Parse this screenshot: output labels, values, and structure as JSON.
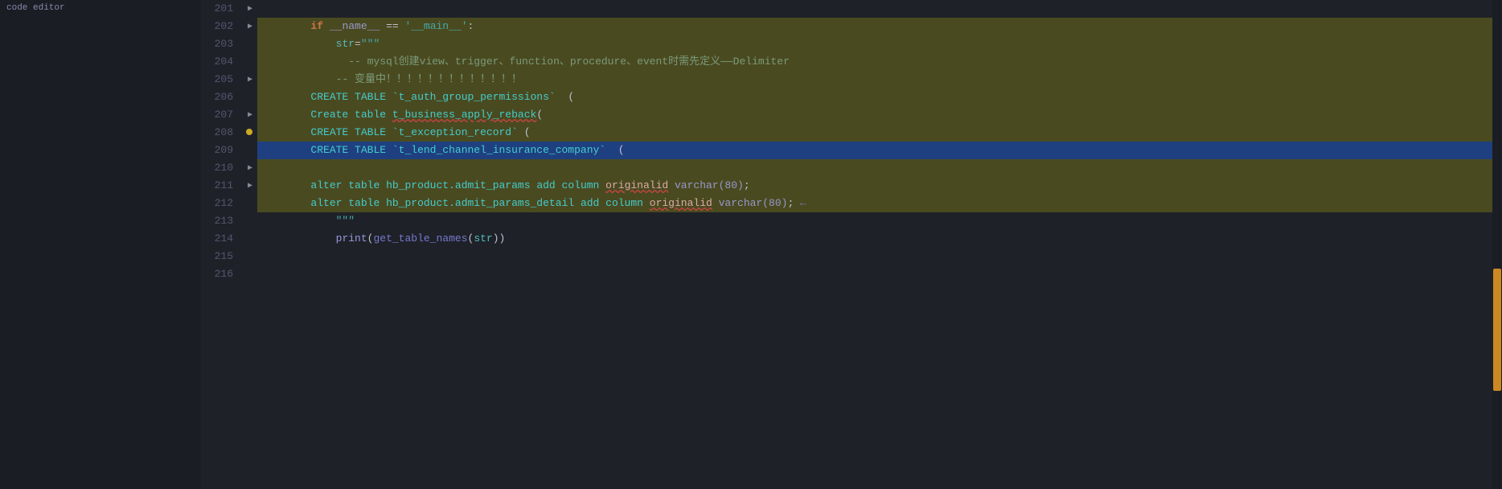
{
  "editor": {
    "title": "code editor",
    "lines": [
      {
        "num": "201",
        "indent": "  ",
        "fold": "▶",
        "gutter": "",
        "content": "if __name__ == '__main__':",
        "type": "normal",
        "tokens": [
          {
            "t": "kw-if",
            "v": "if"
          },
          {
            "t": "",
            "v": " "
          },
          {
            "t": "kw-name",
            "v": "__name__"
          },
          {
            "t": "",
            "v": " == "
          },
          {
            "t": "str-val",
            "v": "'__main__'"
          },
          {
            "t": "",
            "v": ":"
          }
        ]
      },
      {
        "num": "202",
        "indent": "    ",
        "fold": "▶",
        "gutter": "",
        "content": "    str=\"\"\"",
        "type": "highlighted-yellow",
        "tokens": [
          {
            "t": "",
            "v": "    "
          },
          {
            "t": "kw-str",
            "v": "str"
          },
          {
            "t": "",
            "v": "="
          },
          {
            "t": "str-val",
            "v": "\"\"\""
          }
        ]
      },
      {
        "num": "203",
        "indent": "      ",
        "fold": "",
        "gutter": "",
        "content": "      -- mysql创建view、trigger、function、procedure、event时需先定义——Delimiter",
        "type": "highlighted-yellow"
      },
      {
        "num": "204",
        "indent": "      ",
        "fold": "",
        "gutter": "",
        "content": "    -- 变量中！！！！！！！！！！！！！",
        "type": "highlighted-yellow"
      },
      {
        "num": "205",
        "indent": "  ",
        "fold": "▶",
        "gutter": "",
        "content": "CREATE TABLE `t_auth_group_permissions`  (",
        "type": "highlighted-yellow"
      },
      {
        "num": "206",
        "indent": "  ",
        "fold": "",
        "gutter": "",
        "content": "Create table t_business_apply_reback(",
        "type": "highlighted-yellow",
        "squiggle": true
      },
      {
        "num": "207",
        "indent": "  ",
        "fold": "▶",
        "gutter": "",
        "content": "CREATE TABLE `t_exception_record` (",
        "type": "highlighted-yellow"
      },
      {
        "num": "208",
        "indent": "  ",
        "fold": "",
        "gutter": "●",
        "content": "CREATE TABLE `t_lend_channel_insurance_company`  (",
        "type": "highlighted-yellow"
      },
      {
        "num": "209",
        "indent": "",
        "fold": "",
        "gutter": "",
        "content": "",
        "type": "active-line"
      },
      {
        "num": "210",
        "indent": "  ",
        "fold": "▶",
        "gutter": "",
        "content": "alter table hb_product.admit_params add column originalid varchar(80);",
        "type": "highlighted-yellow"
      },
      {
        "num": "211",
        "indent": "  ",
        "fold": "▶",
        "gutter": "",
        "content": "alter table hb_product.admit_params_detail add column originalid varchar(80);",
        "type": "highlighted-yellow",
        "arrow": true
      },
      {
        "num": "212",
        "indent": "    ",
        "fold": "",
        "gutter": "",
        "content": "    \"\"\"",
        "type": "highlighted-yellow"
      },
      {
        "num": "213",
        "indent": "    ",
        "fold": "",
        "gutter": "",
        "content": "    print(get_table_names(str))",
        "type": "normal"
      },
      {
        "num": "214",
        "indent": "",
        "fold": "",
        "gutter": "",
        "content": "",
        "type": "normal"
      },
      {
        "num": "215",
        "indent": "",
        "fold": "",
        "gutter": "",
        "content": "",
        "type": "normal"
      },
      {
        "num": "216",
        "indent": "",
        "fold": "",
        "gutter": "",
        "content": "",
        "type": "normal"
      }
    ],
    "scrollbar": {
      "thumbTop": "60%",
      "thumbHeight": "30%"
    }
  }
}
